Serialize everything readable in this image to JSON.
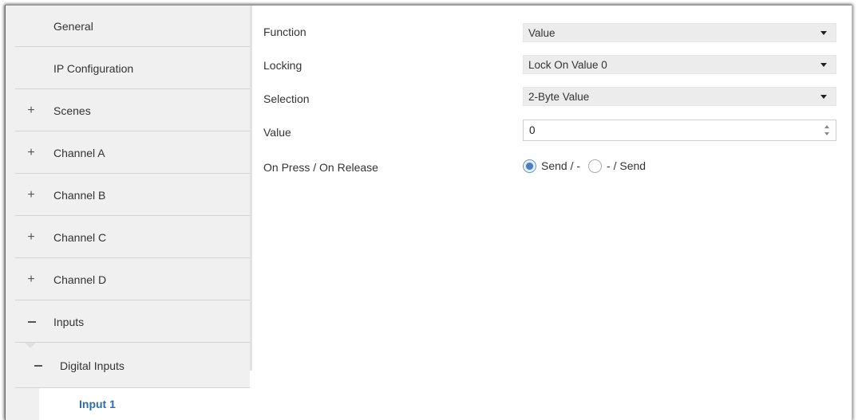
{
  "sidebar": {
    "items": [
      {
        "label": "General",
        "sign": ""
      },
      {
        "label": "IP Configuration",
        "sign": ""
      },
      {
        "label": "Scenes",
        "sign": "+"
      },
      {
        "label": "Channel A",
        "sign": "+"
      },
      {
        "label": "Channel B",
        "sign": "+"
      },
      {
        "label": "Channel C",
        "sign": "+"
      },
      {
        "label": "Channel D",
        "sign": "+"
      },
      {
        "label": "Inputs",
        "sign": "-"
      }
    ],
    "subitem": {
      "label": "Digital Inputs",
      "sign": "-"
    },
    "selected": {
      "label": "Input 1"
    }
  },
  "params": {
    "function": {
      "label": "Function",
      "value": "Value"
    },
    "locking": {
      "label": "Locking",
      "value": "Lock On Value 0"
    },
    "selection": {
      "label": "Selection",
      "value": "2-Byte Value"
    },
    "value": {
      "label": "Value",
      "value": "0"
    },
    "press_release": {
      "label": "On Press / On Release",
      "options": [
        "Send / -",
        "- / Send"
      ],
      "selected": "Send / -"
    }
  },
  "colors": {
    "sidebar_bg": "#f0f0f0",
    "selected_text": "#2e6da4",
    "dropdown_bg": "#ececec",
    "radio_accent": "#4a7cbf"
  }
}
